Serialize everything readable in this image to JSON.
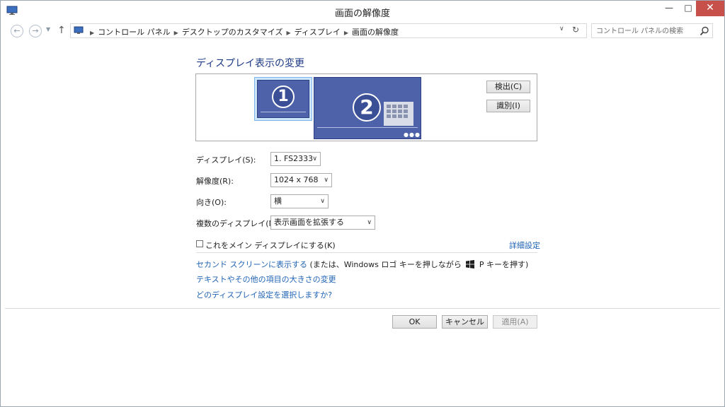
{
  "window": {
    "title": "画面の解像度"
  },
  "title_controls": {
    "minimize": "—",
    "maximize": "□",
    "close": "✕"
  },
  "nav": {
    "back_glyph": "←",
    "forward_glyph": "→",
    "history_glyph": "▼",
    "up_glyph": "↑",
    "breadcrumbs": [
      "コントロール パネル",
      "デスクトップのカスタマイズ",
      "ディスプレイ",
      "画面の解像度"
    ],
    "crumb_separator": "▶",
    "address_dropdown_glyph": "∨",
    "refresh_glyph": "↻",
    "search_placeholder": "コントロール パネルの検索"
  },
  "main": {
    "heading": "ディスプレイ表示の変更",
    "monitors": [
      {
        "number": "1",
        "selected": true
      },
      {
        "number": "2",
        "selected": false
      }
    ],
    "monitor2_dots": "●●●",
    "detect_button": "検出(C)",
    "identify_button": "識別(I)",
    "fields": {
      "display_label": "ディスプレイ(S):",
      "display_value": "1. FS2333",
      "resolution_label": "解像度(R):",
      "resolution_value": "1024 x 768",
      "orientation_label": "向き(O):",
      "orientation_value": "横",
      "multi_display_label": "複数のディスプレイ(M):",
      "multi_display_value": "表示画面を拡張する",
      "dropdown_arrow": "∨"
    },
    "make_main_checkbox_label": "これをメイン ディスプレイにする(K)",
    "make_main_checked": false,
    "advanced_link": "詳細設定",
    "second_screen_link": "セカンド スクリーンに表示する",
    "second_screen_text_before": " (または、Windows ロゴ キーを押しながら ",
    "second_screen_text_after": " P キーを押す)",
    "text_size_link": "テキストやその他の項目の大きさの変更",
    "which_settings_link": "どのディスプレイ設定を選択しますか?"
  },
  "buttons": {
    "ok": "OK",
    "cancel": "キャンセル",
    "apply": "適用(A)"
  },
  "colors": {
    "link": "#1f63b5",
    "heading": "#1e3a87",
    "monitor_fill": "#4d62a8",
    "close_button": "#c7504a"
  }
}
